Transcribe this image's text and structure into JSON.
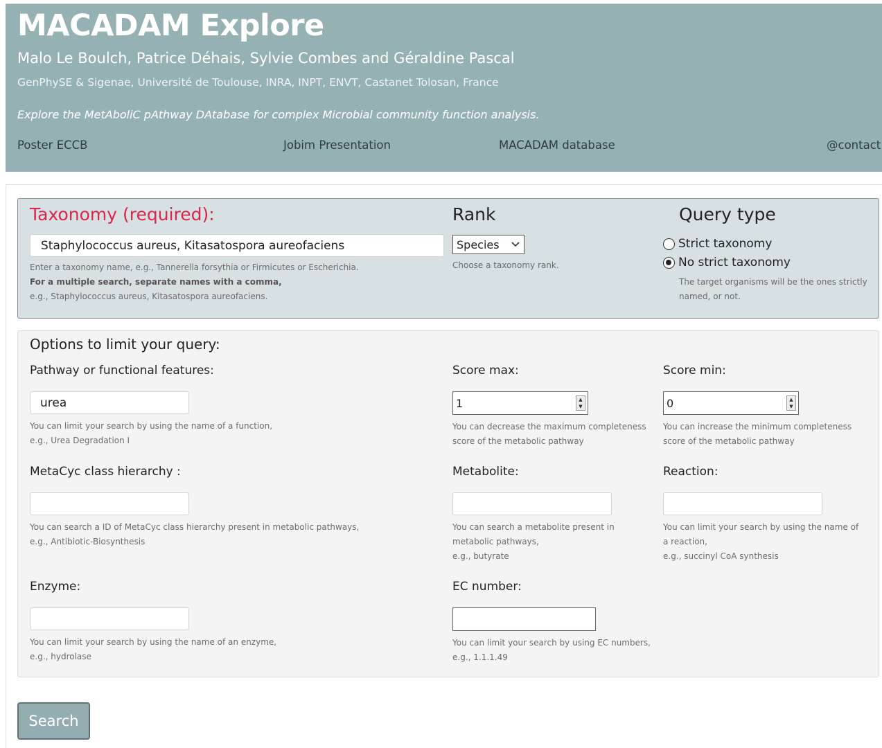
{
  "header": {
    "title": "MACADAM Explore",
    "authors": "Malo Le Boulch, Patrice Déhais, Sylvie Combes and Géraldine Pascal",
    "affiliation": "GenPhySE & Sigenae, Université de Toulouse, INRA, INPT, ENVT, Castanet Tolosan, France",
    "tagline": "Explore the MetAboliC pAthway DAtabase for complex Microbial community function analysis.",
    "nav": [
      "Poster ECCB",
      "Jobim Presentation",
      "MACADAM database",
      "@contact"
    ]
  },
  "taxonomy": {
    "label": "Taxonomy (required):",
    "value": "Staphylococcus aureus, Kitasatospora aureofaciens",
    "help_line1": "Enter a taxonomy name, e.g., Tannerella forsythia or Firmicutes or Escherichia.",
    "help_line2": "For a multiple search, separate names with a comma,",
    "help_line3": "e.g., Staphylococcus aureus, Kitasatospora aureofaciens."
  },
  "rank": {
    "label": "Rank",
    "selected": "Species",
    "help": "Choose a taxonomy rank."
  },
  "query_type": {
    "label": "Query type",
    "option_strict": "Strict taxonomy",
    "option_not_strict": "No strict taxonomy",
    "selected": "No strict taxonomy",
    "help_line1": "The target organisms will be the ones strictly",
    "help_line2": "named, or not."
  },
  "options": {
    "title": "Options to limit your query:",
    "pathway": {
      "label": "Pathway or functional features:",
      "value": "urea",
      "help_line1": "You can limit your search by using the name of a function,",
      "help_line2": "e.g., Urea Degradation I"
    },
    "score_max": {
      "label": "Score max:",
      "value": "1",
      "help_line1": "You can decrease the maximum completeness",
      "help_line2": "score of the metabolic pathway"
    },
    "score_min": {
      "label": "Score min:",
      "value": "0",
      "help_line1": "You can increase the minimum completeness",
      "help_line2": "score of the metabolic pathway"
    },
    "metacyc": {
      "label": "MetaCyc class hierarchy :",
      "value": "",
      "help_line1": "You can search a ID of MetaCyc class hierarchy present in metabolic pathways,",
      "help_line2": "e.g., Antibiotic-Biosynthesis"
    },
    "metabolite": {
      "label": "Metabolite:",
      "value": "",
      "help_line1": "You can search a metabolite present in",
      "help_line2": "metabolic pathways,",
      "help_line3": "e.g., butyrate"
    },
    "reaction": {
      "label": "Reaction:",
      "value": "",
      "help_line1": "You can limit your search by using the name of",
      "help_line2": "a reaction,",
      "help_line3": "e.g., succinyl CoA synthesis"
    },
    "enzyme": {
      "label": "Enzyme:",
      "value": "",
      "help_line1": "You can limit your search by using the name of an enzyme,",
      "help_line2": "e.g., hydrolase"
    },
    "ec_number": {
      "label": "EC number:",
      "value": "",
      "help_line1": "You can limit your search by using EC numbers,",
      "help_line2": "e.g., 1.1.1.49"
    }
  },
  "search_button": "Search"
}
